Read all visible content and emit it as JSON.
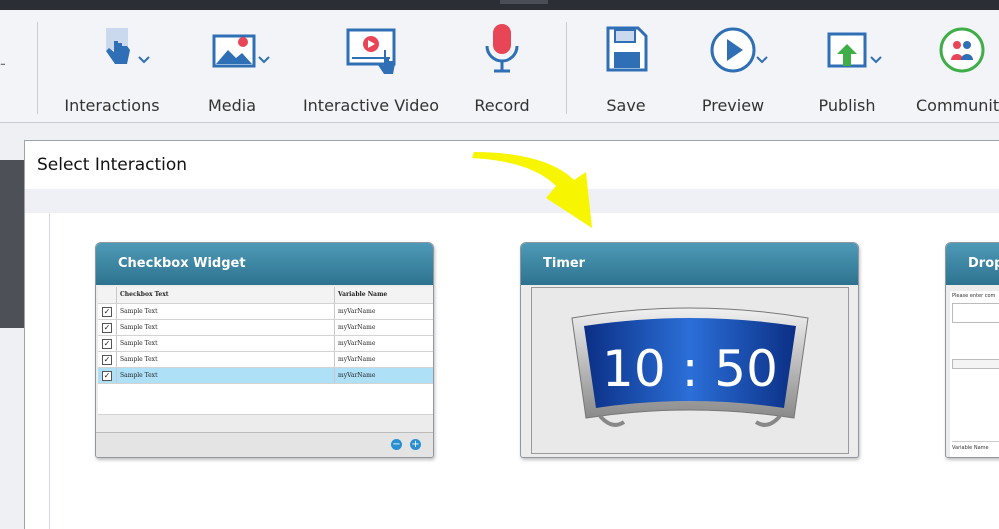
{
  "toolbar": {
    "items": [
      {
        "label": "Interactions",
        "icon": "hand-pointer-icon"
      },
      {
        "label": "Media",
        "icon": "image-icon"
      },
      {
        "label": "Interactive Video",
        "icon": "interactive-video-icon"
      },
      {
        "label": "Record",
        "icon": "microphone-icon"
      },
      {
        "label": "Save",
        "icon": "floppy-disk-icon"
      },
      {
        "label": "Preview",
        "icon": "play-circle-icon"
      },
      {
        "label": "Publish",
        "icon": "publish-icon"
      },
      {
        "label": "Community",
        "icon": "community-icon"
      }
    ],
    "left_hint": "-"
  },
  "dialog": {
    "title": "Select Interaction",
    "cards": [
      {
        "title": "Checkbox Widget",
        "headers": [
          "Checkbox Text",
          "Variable Name"
        ],
        "rows": [
          {
            "text": "Sample Text",
            "var": "myVarName",
            "checked": true
          },
          {
            "text": "Sample Text",
            "var": "myVarName",
            "checked": true
          },
          {
            "text": "Sample Text",
            "var": "myVarName",
            "checked": true
          },
          {
            "text": "Sample Text",
            "var": "myVarName",
            "checked": true
          },
          {
            "text": "Sample Text",
            "var": "myVarName",
            "checked": true
          }
        ]
      },
      {
        "title": "Timer",
        "display": "10 : 50"
      },
      {
        "title": "Drop",
        "prompt": "Please enter com",
        "footer": "Variable Name"
      }
    ]
  },
  "colors": {
    "accent": "#2f6fb5",
    "card_header": "#3a86a4",
    "annotation_arrow": "#f7f500",
    "record_red": "#e84657",
    "publish_green": "#3fae49"
  }
}
